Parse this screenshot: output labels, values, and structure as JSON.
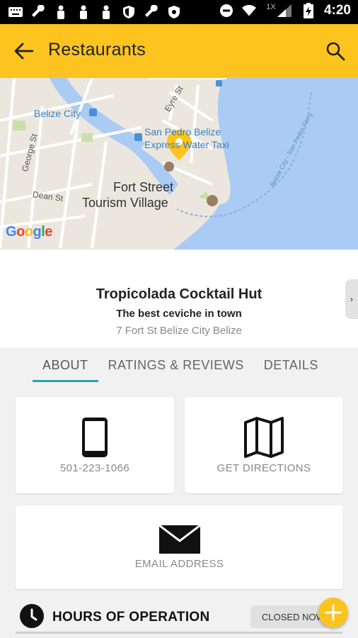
{
  "status_bar": {
    "time": "4:20",
    "signal_label": "1X",
    "icons_left": [
      "keyboard-icon",
      "wrench-icon",
      "figure-icon",
      "figure-icon",
      "figure-icon",
      "shield-icon",
      "wrench-icon",
      "vpn-icon"
    ],
    "icons_right": [
      "do-not-disturb-icon",
      "wifi-icon",
      "cell-signal-icon",
      "battery-charging-icon"
    ]
  },
  "app_bar": {
    "title": "Restaurants",
    "accent_color": "#fdc41f"
  },
  "map": {
    "labels": {
      "belize_city": "Belize City",
      "eyre_st": "Eyre St",
      "george_st": "George St",
      "dean_st": "Dean St",
      "water_taxi_1": "San Pedro Belize",
      "water_taxi_2": "Express Water Taxi",
      "fort_street_1": "Fort Street",
      "fort_street_2": "Tourism Village",
      "ferry_route": "Belize City - San Pedro Ferry",
      "google": "Google"
    },
    "water_color": "#a9cbf3",
    "land_color": "#e9e5dc",
    "pin_color": "#fdc41f"
  },
  "place": {
    "name": "Tropicolada Cocktail Hut",
    "tagline": "The best ceviche in town",
    "address": "7 Fort St Belize City Belize",
    "handle_glyph": "›"
  },
  "tabs": [
    {
      "label": "ABOUT",
      "active": true
    },
    {
      "label": "RATINGS & REVIEWS",
      "active": false
    },
    {
      "label": "DETAILS",
      "active": false
    }
  ],
  "actions": {
    "phone": "501-223-1066",
    "directions": "GET DIRECTIONS",
    "email": "EMAIL ADDRESS"
  },
  "hours": {
    "title": "HOURS OF OPERATION",
    "status": "CLOSED NOW"
  },
  "fab": {
    "icon": "plus-icon"
  }
}
